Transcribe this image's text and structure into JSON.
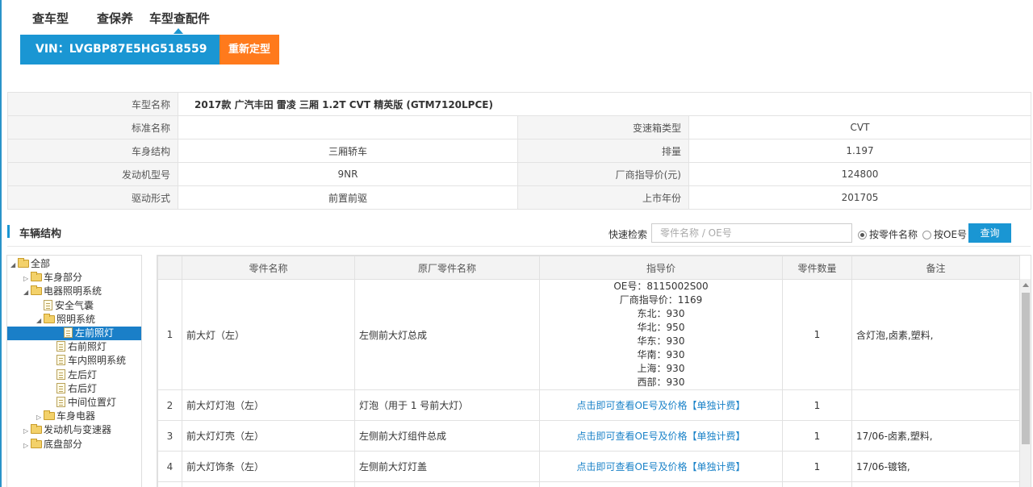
{
  "tabs": [
    {
      "label": "查车型"
    },
    {
      "label": "查保养"
    },
    {
      "label": "车型查配件"
    }
  ],
  "vin": {
    "text": "VIN：LVGBP87E5HG518559",
    "reset_label": "重新定型"
  },
  "info": {
    "model_name_label": "车型名称",
    "model_name": "2017款 广汽丰田 雷凌 三厢 1.2T CVT 精英版 (GTM7120LPCE)",
    "rows": [
      {
        "k1": "标准名称",
        "v1": "",
        "k2": "变速箱类型",
        "v2": "CVT"
      },
      {
        "k1": "车身结构",
        "v1": "三厢轿车",
        "k2": "排量",
        "v2": "1.197"
      },
      {
        "k1": "发动机型号",
        "v1": "9NR",
        "k2": "厂商指导价(元)",
        "v2": "124800"
      },
      {
        "k1": "驱动形式",
        "v1": "前置前驱",
        "k2": "上市年份",
        "v2": "201705"
      }
    ]
  },
  "section": {
    "title": "车辆结构"
  },
  "search": {
    "label": "快速检索",
    "placeholder": "零件名称 / OE号",
    "radio_name": "按零件名称",
    "radio_oe": "按OE号",
    "button": "查询"
  },
  "tree": [
    {
      "label": "全部",
      "arrow": "◢",
      "icon": "folder",
      "level": 0
    },
    {
      "label": "车身部分",
      "arrow": "▷",
      "icon": "folder",
      "level": 1
    },
    {
      "label": "电器照明系统",
      "arrow": "◢",
      "icon": "folder",
      "level": 1
    },
    {
      "label": "安全气囊",
      "arrow": "",
      "icon": "doc",
      "level": 2
    },
    {
      "label": "照明系统",
      "arrow": "◢",
      "icon": "folder",
      "level": 2
    },
    {
      "label": "左前照灯",
      "arrow": "",
      "icon": "doc",
      "level": 3,
      "selected": true
    },
    {
      "label": "右前照灯",
      "arrow": "",
      "icon": "doc",
      "level": 3
    },
    {
      "label": "车内照明系统",
      "arrow": "",
      "icon": "doc",
      "level": 3
    },
    {
      "label": "左后灯",
      "arrow": "",
      "icon": "doc",
      "level": 3
    },
    {
      "label": "右后灯",
      "arrow": "",
      "icon": "doc",
      "level": 3
    },
    {
      "label": "中间位置灯",
      "arrow": "",
      "icon": "doc",
      "level": 3
    },
    {
      "label": "车身电器",
      "arrow": "▷",
      "icon": "folder",
      "level": 2
    },
    {
      "label": "发动机与变速器",
      "arrow": "▷",
      "icon": "folder",
      "level": 1
    },
    {
      "label": "底盘部分",
      "arrow": "▷",
      "icon": "folder",
      "level": 1
    }
  ],
  "grid": {
    "headers": [
      "",
      "零件名称",
      "原厂零件名称",
      "指导价",
      "零件数量",
      "备注"
    ],
    "rows": [
      {
        "no": "1",
        "name": "前大灯（左）",
        "oem_name": "左侧前大灯总成",
        "price_lines": [
          "OE号：8115002S00",
          "厂商指导价：1169",
          "东北：930",
          "华北：950",
          "华东：930",
          "华南：930",
          "上海：930",
          "西部：930"
        ],
        "qty": "1",
        "note": "含灯泡,卤素,塑料,"
      },
      {
        "no": "2",
        "name": "前大灯灯泡（左）",
        "oem_name": "灯泡（用于 1 号前大灯）",
        "price_link": "点击即可查看OE号及价格【单独计费】",
        "qty": "1",
        "note": ""
      },
      {
        "no": "3",
        "name": "前大灯灯壳（左）",
        "oem_name": "左侧前大灯组件总成",
        "price_link": "点击即可查看OE号及价格【单独计费】",
        "qty": "1",
        "note": "17/06-卤素,塑料,"
      },
      {
        "no": "4",
        "name": "前大灯饰条（左）",
        "oem_name": "左侧前大灯灯盖",
        "price_link": "点击即可查看OE号及价格【单独计费】",
        "qty": "1",
        "note": "17/06-镀铬,"
      }
    ]
  }
}
